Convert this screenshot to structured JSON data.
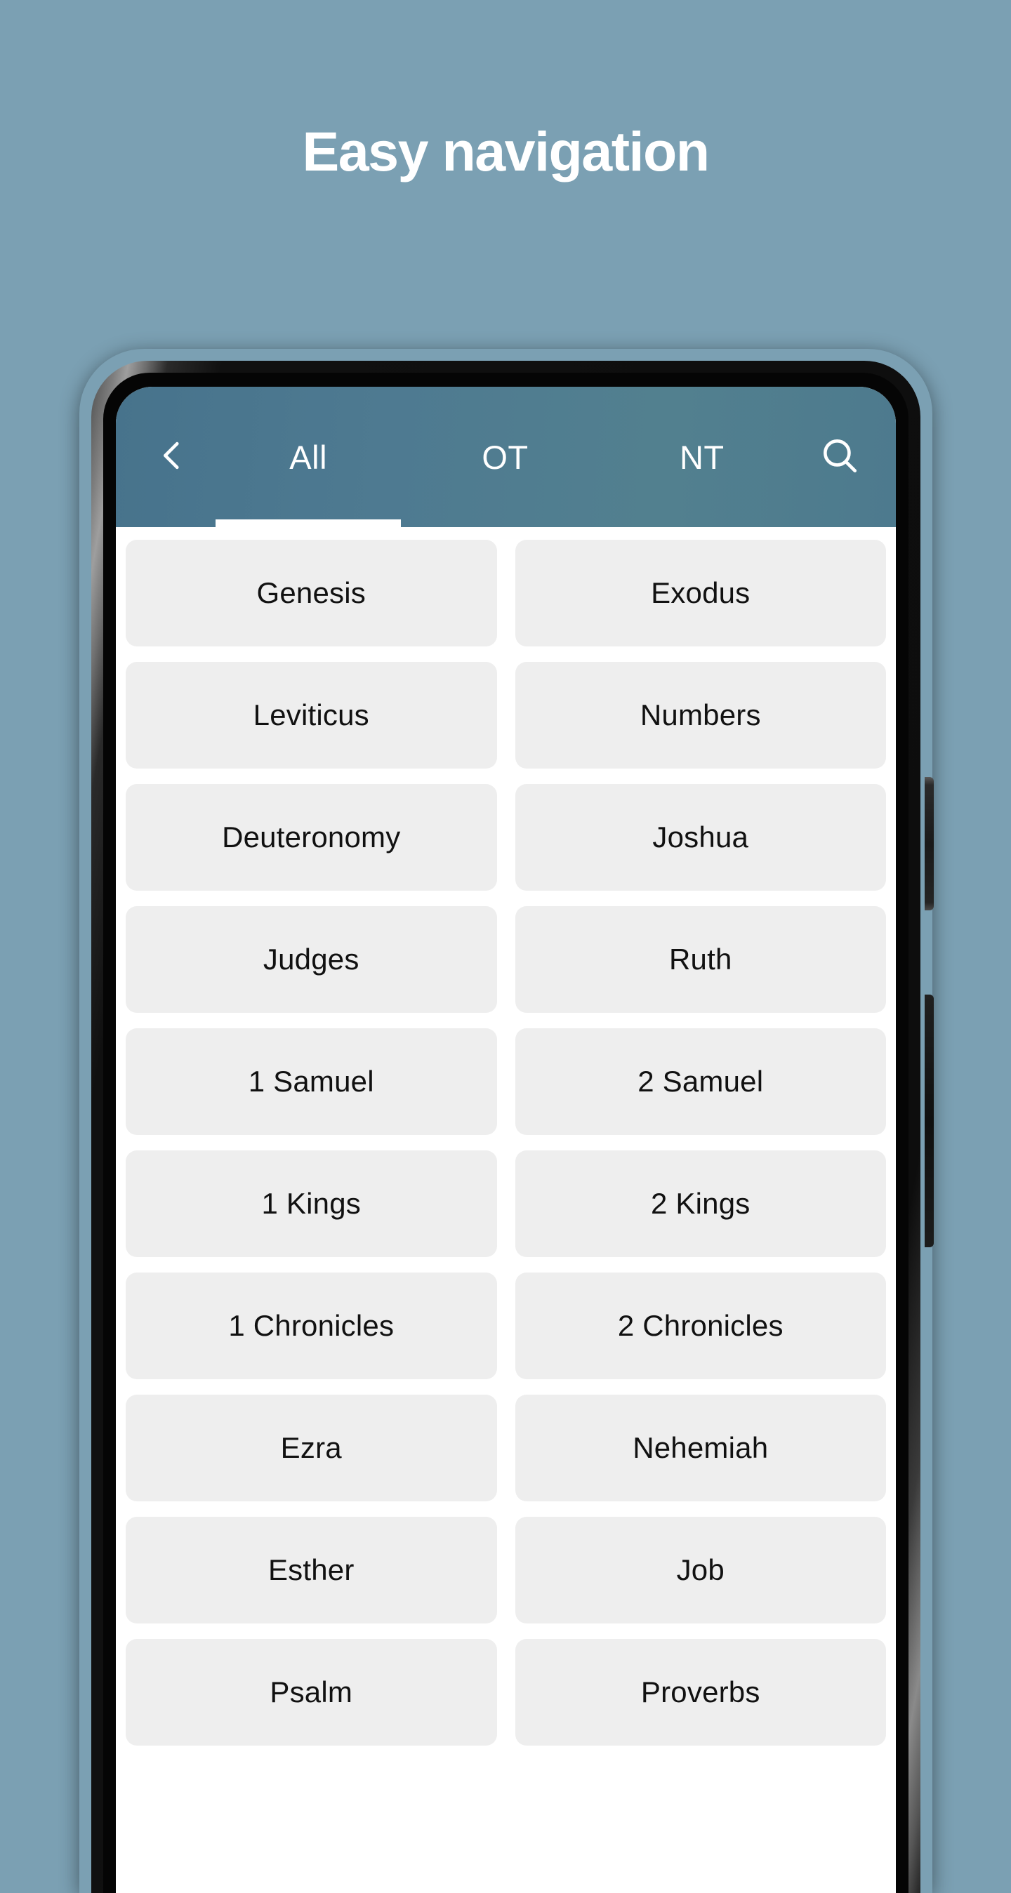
{
  "promo": {
    "headline": "Easy navigation",
    "background_color": "#7ba0b3"
  },
  "app": {
    "appbar": {
      "background_color": "#4e7a91",
      "back_icon": "chevron-left-icon",
      "search_icon": "search-icon",
      "tabs": [
        {
          "label": "All",
          "active": true
        },
        {
          "label": "OT",
          "active": false
        },
        {
          "label": "NT",
          "active": false
        }
      ],
      "indicator_color": "#ffffff"
    },
    "content": {
      "background_color": "#ffffff",
      "button_color": "#eeeeee",
      "button_text_color": "#111111",
      "books": [
        "Genesis",
        "Exodus",
        "Leviticus",
        "Numbers",
        "Deuteronomy",
        "Joshua",
        "Judges",
        "Ruth",
        "1 Samuel",
        "2 Samuel",
        "1 Kings",
        "2 Kings",
        "1 Chronicles",
        "2 Chronicles",
        "Ezra",
        "Nehemiah",
        "Esther",
        "Job",
        "Psalm",
        "Proverbs"
      ]
    }
  },
  "device": {
    "side_buttons": [
      "power-button",
      "volume-rocker"
    ]
  }
}
